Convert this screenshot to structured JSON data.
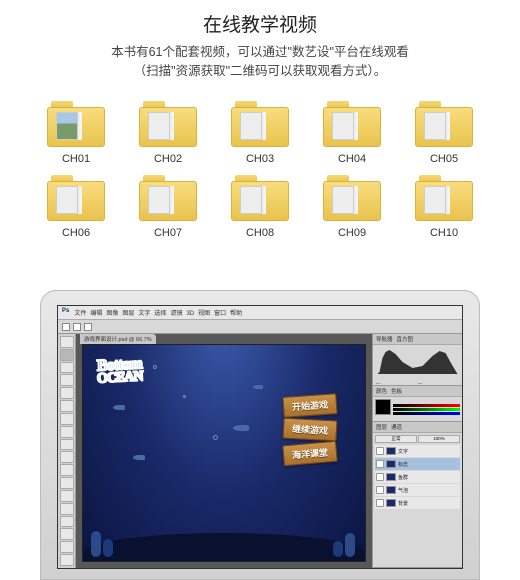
{
  "header": {
    "title": "在线教学视频",
    "subtitle_line1": "本书有61个配套视频，可以通过\"数艺设\"平台在线观看",
    "subtitle_line2": "（扫描\"资源获取\"二维码可以获取观看方式）。"
  },
  "folders": [
    {
      "label": "CH01",
      "thumb": "photo"
    },
    {
      "label": "CH02",
      "thumb": "ui"
    },
    {
      "label": "CH03",
      "thumb": "ui"
    },
    {
      "label": "CH04",
      "thumb": "ui"
    },
    {
      "label": "CH05",
      "thumb": "ui"
    },
    {
      "label": "CH06",
      "thumb": "ui"
    },
    {
      "label": "CH07",
      "thumb": "ui"
    },
    {
      "label": "CH08",
      "thumb": "ui"
    },
    {
      "label": "CH09",
      "thumb": "ui"
    },
    {
      "label": "CH10",
      "thumb": "ui"
    }
  ],
  "photoshop": {
    "app_label": "Ps",
    "menus": [
      "文件",
      "编辑",
      "图像",
      "图层",
      "文字",
      "选择",
      "滤镜",
      "3D",
      "视图",
      "窗口",
      "帮助"
    ],
    "document_tab": "游戏界面设计.psd @ 66.7%",
    "panels": {
      "histogram_label": "直方图",
      "nav_label": "导航器",
      "color_label": "颜色",
      "swatch_label": "色板",
      "layers_label": "图层",
      "channels_label": "通道",
      "blend_mode": "正常",
      "opacity_label": "100%"
    },
    "layers": [
      {
        "name": "文字",
        "selected": false
      },
      {
        "name": "标志",
        "selected": true
      },
      {
        "name": "鱼群",
        "selected": false
      },
      {
        "name": "气泡",
        "selected": false
      },
      {
        "name": "背景",
        "selected": false
      }
    ],
    "canvas": {
      "logo_line1": "Bottom",
      "logo_line2": "OCEAN",
      "signs": [
        "开始游戏",
        "继续游戏",
        "海洋课堂"
      ]
    }
  }
}
